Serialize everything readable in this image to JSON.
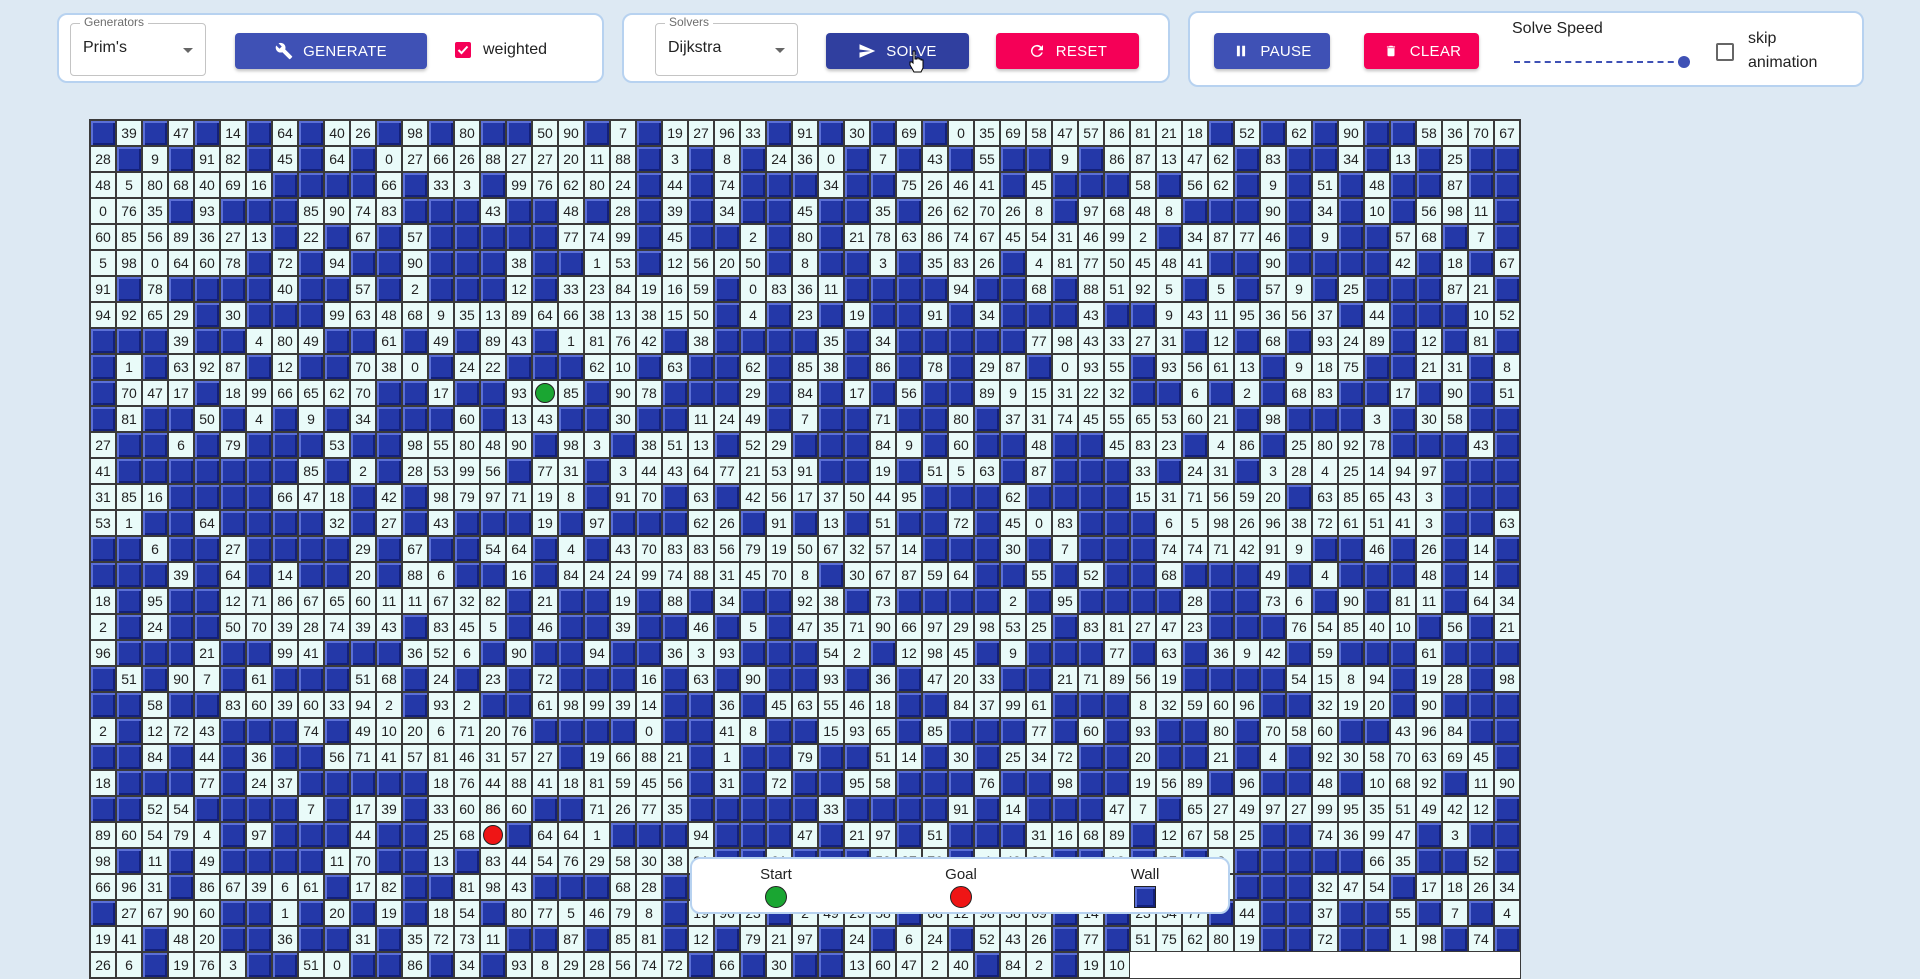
{
  "generators": {
    "legend": "Generators",
    "selected": "Prim's",
    "generate_label": "GENERATE",
    "weighted_label": "weighted",
    "weighted_checked": true
  },
  "solvers": {
    "legend": "Solvers",
    "selected": "Dijkstra",
    "solve_label": "SOLVE",
    "reset_label": "RESET"
  },
  "controls": {
    "pause_label": "PAUSE",
    "clear_label": "CLEAR",
    "speed_label": "Solve Speed",
    "speed_value": 1.0,
    "skip_label": "skip animation",
    "skip_checked": false
  },
  "legend": {
    "start_label": "Start",
    "goal_label": "Goal",
    "wall_label": "Wall"
  },
  "colors": {
    "primary": "#3f51b5",
    "secondary": "#f50057",
    "wall": "#2438a8",
    "open_cell": "#e9fbf9",
    "start": "#1aa632",
    "goal": "#ef1515"
  },
  "maze": {
    "start": {
      "row": 8,
      "col": 31
    },
    "goal": {
      "row": 21,
      "col": 23
    },
    "rows": [
      "# 39 # 47 # 14 # 64 # 40 26 # 98 # 80 # # 50 90 # 7 # 19 27 96 33 # 91 # 30 # 69 # 0 35 69 58 47 57 86 81 21 18 # 52 # 62 # 90 # # 58 36 70 67 28 # 9 # 91 82 # 45 # 64 # 0",
      "27 66 26 88 27 27 20 11 88 # 3 # 8 # 24 36 0 # 7 # 43 # 55 # # 9 # 86 87 13 47 62 # 83 # # 34 # 13 # 25 # # 48 5 80 68 40 69 16 # # # # 66 # 33 3 # 99 76 62 80 24 # 44",
      "# 74 # # # 34 # # 75 26 46 41 # 45 # # # 58 # 56 62 # 9 # 51 # 48 # # 87 # # 0 76 35 # 93 # # # 85 90 74 83 # # # 43 # # 48 # 28 # 39 # 34 # # 45 # # 35 # 26",
      "62 70 26 8 # 97 68 48 8 # # # 90 # 34 # 10 # 56 98 11 # 60 85 56 89 36 27 13 # 22 # 67 # 57 # # # # # 77 74 99 # 45 # # 2 # 80 # 21 78 63 86 74 67 45 54 31 46 99 2 # 34 87 77 46",
      "# 9 # # 57 68 # 7 # 5 98 0 64 60 78 # 72 # 94 # # 90 # # # 38 # # 1 53 # 12 56 20 50 # 8 # # 3 # 35 83 26 # 4 81 77 50 45 48 41 # # 90 # # # # 42 # 18 # 67 91 #",
      "78 # # # # 40 # # 57 # 2 # # # 12 # 33 23 84 19 16 59 # 0 83 36 11 # # # # 94 # # 68 # 88 51 92 5 # 5 # 57 9 # 25 # # # 87 21 # 94 92 65 29 # 30 # # # 99 63 48 68",
      "9 35 13 89 64 66 38 13 38 15 50 # 4 # 23 # 19 # # 91 # 34 # # # 43 # # 9 43 11 95 36 56 37 # 44 # # # 10 52 # # # 39 # # 4 80 49 # # 61 # 49 # 89 43 # 1 81 76 42 # 38 #",
      "# # # 35 # 34 # # # # # 77 98 43 33 27 31 # 12 # 68 # 93 24 89 # 12 # 81 # # 1 # 63 92 87 # 12 # # 70 38 0 # 24 22 # # # 62 10 # 63 # # 62 # 85 38 # 86 # 78 # 29 87",
      "# 0 93 55 # 93 56 61 13 # 9 18 75 # # 21 31 # 8 # 70 47 17 # 18 99 66 65 62 70 # # 17 # # 93 S 85 # 90 78 # # # 29 # 84 # 17 # 56 # # 89 9 15 31 22 32 # # 6 # 2 # 68",
      "83 # # 17 # 90 # 51 # 81 # # 50 # 4 # 9 # 34 # # # 60 # 13 43 # # 30 # # 11 24 49 # 7 # # 71 # # 80 # 37 31 74 45 55 65 53 60 21 # 98 # # # 3 # 30 58 # # 27 # # 6 #",
      "79 # # # 53 # # 98 55 80 48 90 # 98 3 # 38 51 13 # 52 29 # # # 84 9 # 60 # # 48 # # 45 83 23 # 4 86 # 25 80 92 78 # # # 43 # 41 # # # # # # # 85 # 2 # 28 53 99 56 # 77",
      "31 # 3 44 43 64 77 21 53 91 # # 19 # 51 5 63 # 87 # # # 33 # 24 31 # 3 28 4 25 14 94 97 # # # 31 85 16 # # # # 66 47 18 # 42 # 98 79 97 71 19 8 # 91 70 # 63 # 42 56 17 37 50 44",
      "95 # # # 62 # # # # 15 31 71 56 59 20 # 63 85 65 43 3 # # # 53 1 # # 64 # # # # 32 # 27 # 43 # # # 19 # 97 # # # 62 26 # 91 # 13 # 51 # # 72 # 45 0 83 # # # 6",
      "5 98 26 96 38 72 61 51 41 3 # # 63 # # 6 # # 27 # # # # 29 # 67 # # 54 64 # 4 # 43 70 83 83 56 79 19 50 67 32 57 14 # # # 30 # 7 # # # 74 74 71 42 91 9 # # 46 # 26 # 14 #",
      "# # # 39 # 64 # 14 # # 20 # 88 6 # # 16 # 84 24 24 99 74 88 31 45 70 8 # 30 67 87 59 64 # # 55 # 52 # # 68 # # # 49 # 4 # # # 48 # 14 # 18 # 95 # # 12 71 86 67 65 60 11",
      "11 67 32 82 # 21 # # 19 # 88 # 34 # # 92 38 # 73 # # # # 2 # 95 # # # # 28 # # 73 6 # 90 # 81 11 # 64 34 2 # 24 # # 50 70 39 28 74 39 43 # 83 45 5 # 46 # # 39 #",
      "# 46 # 5 # 47 35 71 90 66 97 29 98 53 25 # 83 81 27 47 23 # # # 76 54 85 40 10 # 56 # 21 96 # # # 21 # # 99 41 # # # 36 52 6 # 90 # # 94 # # 36 3 93 # # # 54 2 # 12 98 45",
      "# 9 # # # 77 # 63 # 36 9 42 # 59 # # # 61 # # # # 51 # 90 7 # 61 # # # 51 68 # 24 # 23 # 72 # # # 16 # 63 # 90 # # 93 # 36 # 47 20 33 # # 21 71 89 56 19 # # # # 54",
      "15 8 94 # 19 28 # 98 # # 58 # # 83 60 39 60 33 94 2 # 93 2 # # 61 98 99 39 14 # # 36 # 45 63 55 46 18 # # 84 37 99 61 # # # 8 32 59 60 96 # # 32 19 20 # 90 # # # 2 # 12",
      "72 43 # # # 74 # 49 10 20 6 71 20 76 # # # # 0 # # 41 8 # # 15 93 65 # 85 # # # 77 # 60 # 93 # # 80 # 70 58 60 # # 43 96 84 # # # # 84 # 44 # 36 # # 56 71 41 57 81 46 31 57",
      "27 # 19 66 88 21 # 1 # # 79 # # 51 14 # 30 # 25 34 72 # # 20 # # 21 # 4 # 92 30 58 70 63 69 45 # 18 # # # 77 # 24 37 # # # # # 18 76 44 88 41 18 81 59 45 56 # 31 # 72 # # 95",
      "58 # # # 76 # # 98 # # 19 56 89 # 96 # # 48 # 10 68 92 # 11 90 # # 52 54 # # # # 7 # 17 39 # 33 60 86 60 # # 71 26 77 35 # # # # # 33 # # # # 91 # 14 # # # 47 7 # 65",
      "27 49 97 27 99 95 35 51 49 42 12 # 89 60 54 79 4 # 97 # # # 44 # # 25 68 G # 64 64 1 # # # 94 # # # 47 # 21 97 # 51 # # # 31 16 68 89 # 12 67 58 25 # # 74 36 99 47 #",
      "3 # # 98 # 11 # 49 # # # # 11 70 # # 13 # 83 44 54 76 29 58 30 38 81 # # 91 # # # 50 87 76 # 4 40 88 # # 10 # 37 # 2 # # # # # 66 35 # # 52 # 66 96 31 # 86 67 39 6",
      "61 # 17 82 # # 81 98 43 # # # 68 28 # # 64 # # 84 # 90 # # # 38 83 98 21 74 91 4 # 59 # 10 # # # 32 47 54 # 17 18 26 34 # 27 67 90 60 # # 1 # 20 # 19 # 18 54 # 80 77",
      "5 46 79 8 # 19 96 23 # 2 49 25 58 # 68 12 98 38 69 # 14 # 23 54 77 # 44 # # 37 # # 55 # 7 # 4 19 41 # 48 20 # # 36 # # 31 # 35 72 73 11 # # 87 # 85 81 # 12 # 79 21",
      "97 # 24 # 6 24 # 52 43 26 # 77 # 51 75 62 80 19 # # 72 # # 1 98 # 74 # 26 6 # 19 76 3 # # 51 0 # # 86 # 34 # 93 8 29 28 56 74 72 # 66 # 30 # # 13 60 47 2 40 # 84 2 # 19 10"
    ]
  }
}
